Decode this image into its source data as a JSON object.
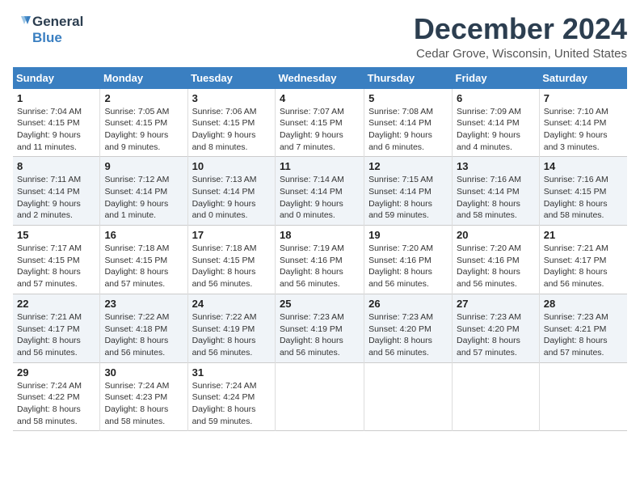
{
  "logo": {
    "line1": "General",
    "line2": "Blue"
  },
  "title": "December 2024",
  "subtitle": "Cedar Grove, Wisconsin, United States",
  "days_of_week": [
    "Sunday",
    "Monday",
    "Tuesday",
    "Wednesday",
    "Thursday",
    "Friday",
    "Saturday"
  ],
  "weeks": [
    [
      {
        "day": "1",
        "sunrise": "7:04 AM",
        "sunset": "4:15 PM",
        "daylight": "9 hours and 11 minutes."
      },
      {
        "day": "2",
        "sunrise": "7:05 AM",
        "sunset": "4:15 PM",
        "daylight": "9 hours and 9 minutes."
      },
      {
        "day": "3",
        "sunrise": "7:06 AM",
        "sunset": "4:15 PM",
        "daylight": "9 hours and 8 minutes."
      },
      {
        "day": "4",
        "sunrise": "7:07 AM",
        "sunset": "4:15 PM",
        "daylight": "9 hours and 7 minutes."
      },
      {
        "day": "5",
        "sunrise": "7:08 AM",
        "sunset": "4:14 PM",
        "daylight": "9 hours and 6 minutes."
      },
      {
        "day": "6",
        "sunrise": "7:09 AM",
        "sunset": "4:14 PM",
        "daylight": "9 hours and 4 minutes."
      },
      {
        "day": "7",
        "sunrise": "7:10 AM",
        "sunset": "4:14 PM",
        "daylight": "9 hours and 3 minutes."
      }
    ],
    [
      {
        "day": "8",
        "sunrise": "7:11 AM",
        "sunset": "4:14 PM",
        "daylight": "9 hours and 2 minutes."
      },
      {
        "day": "9",
        "sunrise": "7:12 AM",
        "sunset": "4:14 PM",
        "daylight": "9 hours and 1 minute."
      },
      {
        "day": "10",
        "sunrise": "7:13 AM",
        "sunset": "4:14 PM",
        "daylight": "9 hours and 0 minutes."
      },
      {
        "day": "11",
        "sunrise": "7:14 AM",
        "sunset": "4:14 PM",
        "daylight": "9 hours and 0 minutes."
      },
      {
        "day": "12",
        "sunrise": "7:15 AM",
        "sunset": "4:14 PM",
        "daylight": "8 hours and 59 minutes."
      },
      {
        "day": "13",
        "sunrise": "7:16 AM",
        "sunset": "4:14 PM",
        "daylight": "8 hours and 58 minutes."
      },
      {
        "day": "14",
        "sunrise": "7:16 AM",
        "sunset": "4:15 PM",
        "daylight": "8 hours and 58 minutes."
      }
    ],
    [
      {
        "day": "15",
        "sunrise": "7:17 AM",
        "sunset": "4:15 PM",
        "daylight": "8 hours and 57 minutes."
      },
      {
        "day": "16",
        "sunrise": "7:18 AM",
        "sunset": "4:15 PM",
        "daylight": "8 hours and 57 minutes."
      },
      {
        "day": "17",
        "sunrise": "7:18 AM",
        "sunset": "4:15 PM",
        "daylight": "8 hours and 56 minutes."
      },
      {
        "day": "18",
        "sunrise": "7:19 AM",
        "sunset": "4:16 PM",
        "daylight": "8 hours and 56 minutes."
      },
      {
        "day": "19",
        "sunrise": "7:20 AM",
        "sunset": "4:16 PM",
        "daylight": "8 hours and 56 minutes."
      },
      {
        "day": "20",
        "sunrise": "7:20 AM",
        "sunset": "4:16 PM",
        "daylight": "8 hours and 56 minutes."
      },
      {
        "day": "21",
        "sunrise": "7:21 AM",
        "sunset": "4:17 PM",
        "daylight": "8 hours and 56 minutes."
      }
    ],
    [
      {
        "day": "22",
        "sunrise": "7:21 AM",
        "sunset": "4:17 PM",
        "daylight": "8 hours and 56 minutes."
      },
      {
        "day": "23",
        "sunrise": "7:22 AM",
        "sunset": "4:18 PM",
        "daylight": "8 hours and 56 minutes."
      },
      {
        "day": "24",
        "sunrise": "7:22 AM",
        "sunset": "4:19 PM",
        "daylight": "8 hours and 56 minutes."
      },
      {
        "day": "25",
        "sunrise": "7:23 AM",
        "sunset": "4:19 PM",
        "daylight": "8 hours and 56 minutes."
      },
      {
        "day": "26",
        "sunrise": "7:23 AM",
        "sunset": "4:20 PM",
        "daylight": "8 hours and 56 minutes."
      },
      {
        "day": "27",
        "sunrise": "7:23 AM",
        "sunset": "4:20 PM",
        "daylight": "8 hours and 57 minutes."
      },
      {
        "day": "28",
        "sunrise": "7:23 AM",
        "sunset": "4:21 PM",
        "daylight": "8 hours and 57 minutes."
      }
    ],
    [
      {
        "day": "29",
        "sunrise": "7:24 AM",
        "sunset": "4:22 PM",
        "daylight": "8 hours and 58 minutes."
      },
      {
        "day": "30",
        "sunrise": "7:24 AM",
        "sunset": "4:23 PM",
        "daylight": "8 hours and 58 minutes."
      },
      {
        "day": "31",
        "sunrise": "7:24 AM",
        "sunset": "4:24 PM",
        "daylight": "8 hours and 59 minutes."
      },
      null,
      null,
      null,
      null
    ]
  ],
  "labels": {
    "sunrise": "Sunrise:",
    "sunset": "Sunset:",
    "daylight": "Daylight:"
  }
}
